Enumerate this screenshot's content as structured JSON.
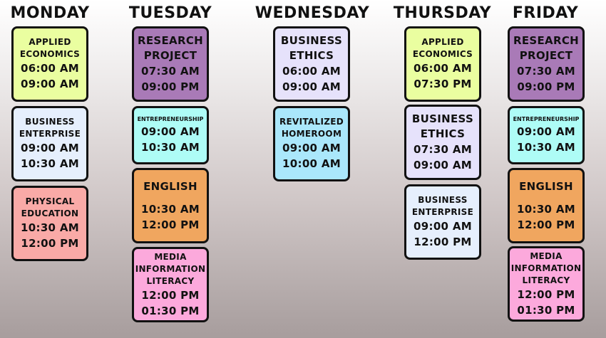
{
  "colors": {
    "yellow": "#eafea0",
    "lavender": "#e6e2fb",
    "pink_red": "#f9aaa7",
    "purple": "#a97ab7",
    "cyan": "#aefcf6",
    "orange": "#f0a65f",
    "magenta_pink": "#fca9dc",
    "light_blue": "#aae7fb",
    "pale_blue": "#e6effd"
  },
  "days": [
    {
      "name": "MONDAY",
      "classes": [
        {
          "subject": "APPLIED ECONOMICS",
          "start": "06:00 AM",
          "end": "09:00 AM"
        },
        {
          "subject": "BUSINESS ENTERPRISE",
          "start": "09:00 AM",
          "end": "10:30 AM"
        },
        {
          "subject": "PHYSICAL EDUCATION",
          "start": "10:30 AM",
          "end": "12:00 PM"
        }
      ]
    },
    {
      "name": "TUESDAY",
      "classes": [
        {
          "subject": "RESEARCH PROJECT",
          "start": "07:30 AM",
          "end": "09:00 PM"
        },
        {
          "subject": "ENTREPRENEURSHIP",
          "start": "09:00 AM",
          "end": "10:30 AM"
        },
        {
          "subject": "ENGLISH",
          "start": "10:30 AM",
          "end": "12:00 PM"
        },
        {
          "subject": "MEDIA INFORMATION LITERACY",
          "start": "12:00 PM",
          "end": "01:30 PM"
        }
      ]
    },
    {
      "name": "WEDNESDAY",
      "classes": [
        {
          "subject": "BUSINESS ETHICS",
          "start": "06:00 AM",
          "end": "09:00 AM"
        },
        {
          "subject": "REVITALIZED HOMEROOM",
          "start": "09:00 AM",
          "end": "10:00 AM"
        }
      ]
    },
    {
      "name": "THURSDAY",
      "classes": [
        {
          "subject": "APPLIED ECONOMICS",
          "start": "06:00 AM",
          "end": "07:30 PM"
        },
        {
          "subject": "BUSINESS ETHICS",
          "start": "07:30 AM",
          "end": "09:00 AM"
        },
        {
          "subject": "BUSINESS ENTERPRISE",
          "start": "09:00 AM",
          "end": "12:00 PM"
        }
      ]
    },
    {
      "name": "FRIDAY",
      "classes": [
        {
          "subject": "RESEARCH PROJECT",
          "start": "07:30 AM",
          "end": "09:00 PM"
        },
        {
          "subject": "ENTREPRENEURSHIP",
          "start": "09:00 AM",
          "end": "10:30 AM"
        },
        {
          "subject": "ENGLISH",
          "start": "10:30 AM",
          "end": "12:00 PM"
        },
        {
          "subject": "MEDIA INFORMATION LITERACY",
          "start": "12:00 PM",
          "end": "01:30 PM"
        }
      ]
    }
  ]
}
